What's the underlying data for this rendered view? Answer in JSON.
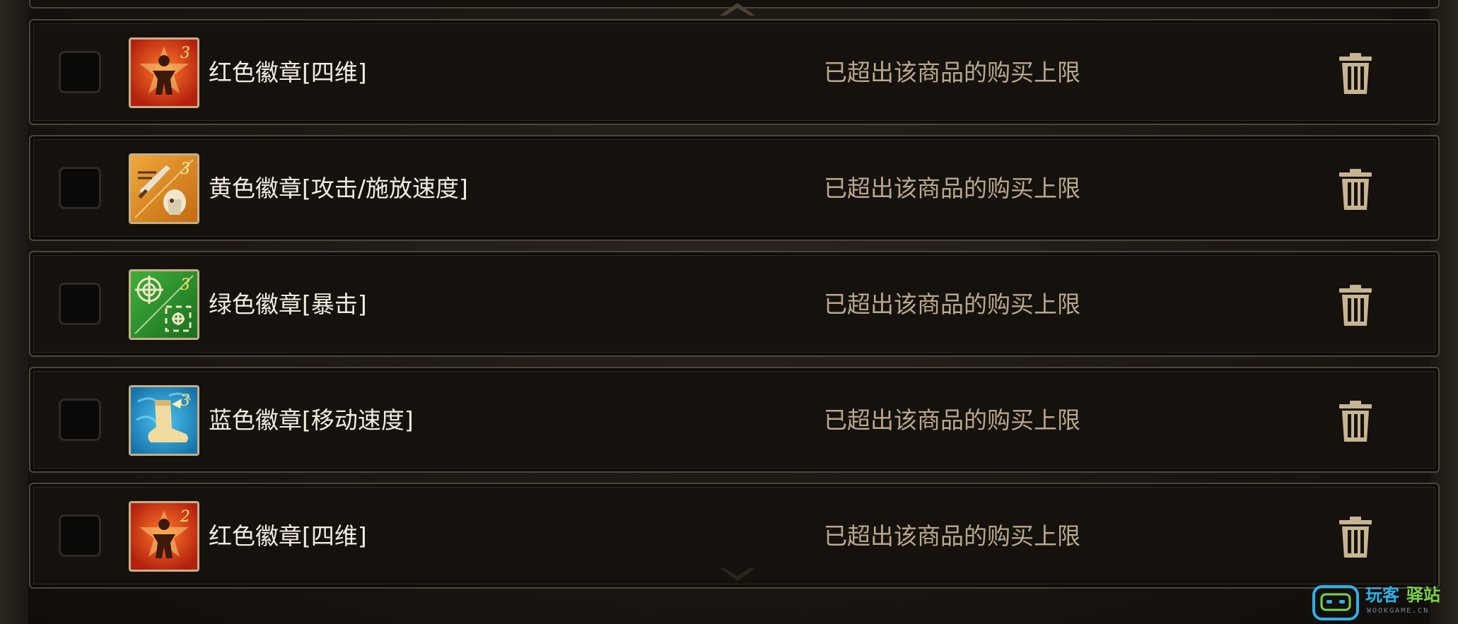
{
  "colors": {
    "background": "#17130f",
    "row_border": "#4d463a",
    "item_name": "#f2ece0",
    "status_text": "#b9a98d",
    "trash_icon": "#c7b592",
    "icon_frame": "#c4b087"
  },
  "cart_items": [
    {
      "name": "红色徽章[四维]",
      "status": "已超出该商品的购买上限",
      "icon": "red-emblem-stats-icon",
      "icon_color": "#c8361b",
      "level": "3",
      "selected": false
    },
    {
      "name": "黄色徽章[攻击/施放速度]",
      "status": "已超出该商品的购买上限",
      "icon": "yellow-emblem-speed-icon",
      "icon_color": "#d9922a",
      "level": "3",
      "selected": false
    },
    {
      "name": "绿色徽章[暴击]",
      "status": "已超出该商品的购买上限",
      "icon": "green-emblem-crit-icon",
      "icon_color": "#2f9a2f",
      "level": "3",
      "selected": false
    },
    {
      "name": "蓝色徽章[移动速度]",
      "status": "已超出该商品的购买上限",
      "icon": "blue-emblem-movespeed-icon",
      "icon_color": "#1f8fc6",
      "level": "3",
      "selected": false
    },
    {
      "name": "红色徽章[四维]",
      "status": "已超出该商品的购买上限",
      "icon": "red-emblem-stats-icon",
      "icon_color": "#c8361b",
      "level": "2",
      "selected": false
    }
  ],
  "watermark": {
    "brand_part1": "玩客",
    "brand_part2": "驿站",
    "domain": "WOOKGAME.CN"
  }
}
